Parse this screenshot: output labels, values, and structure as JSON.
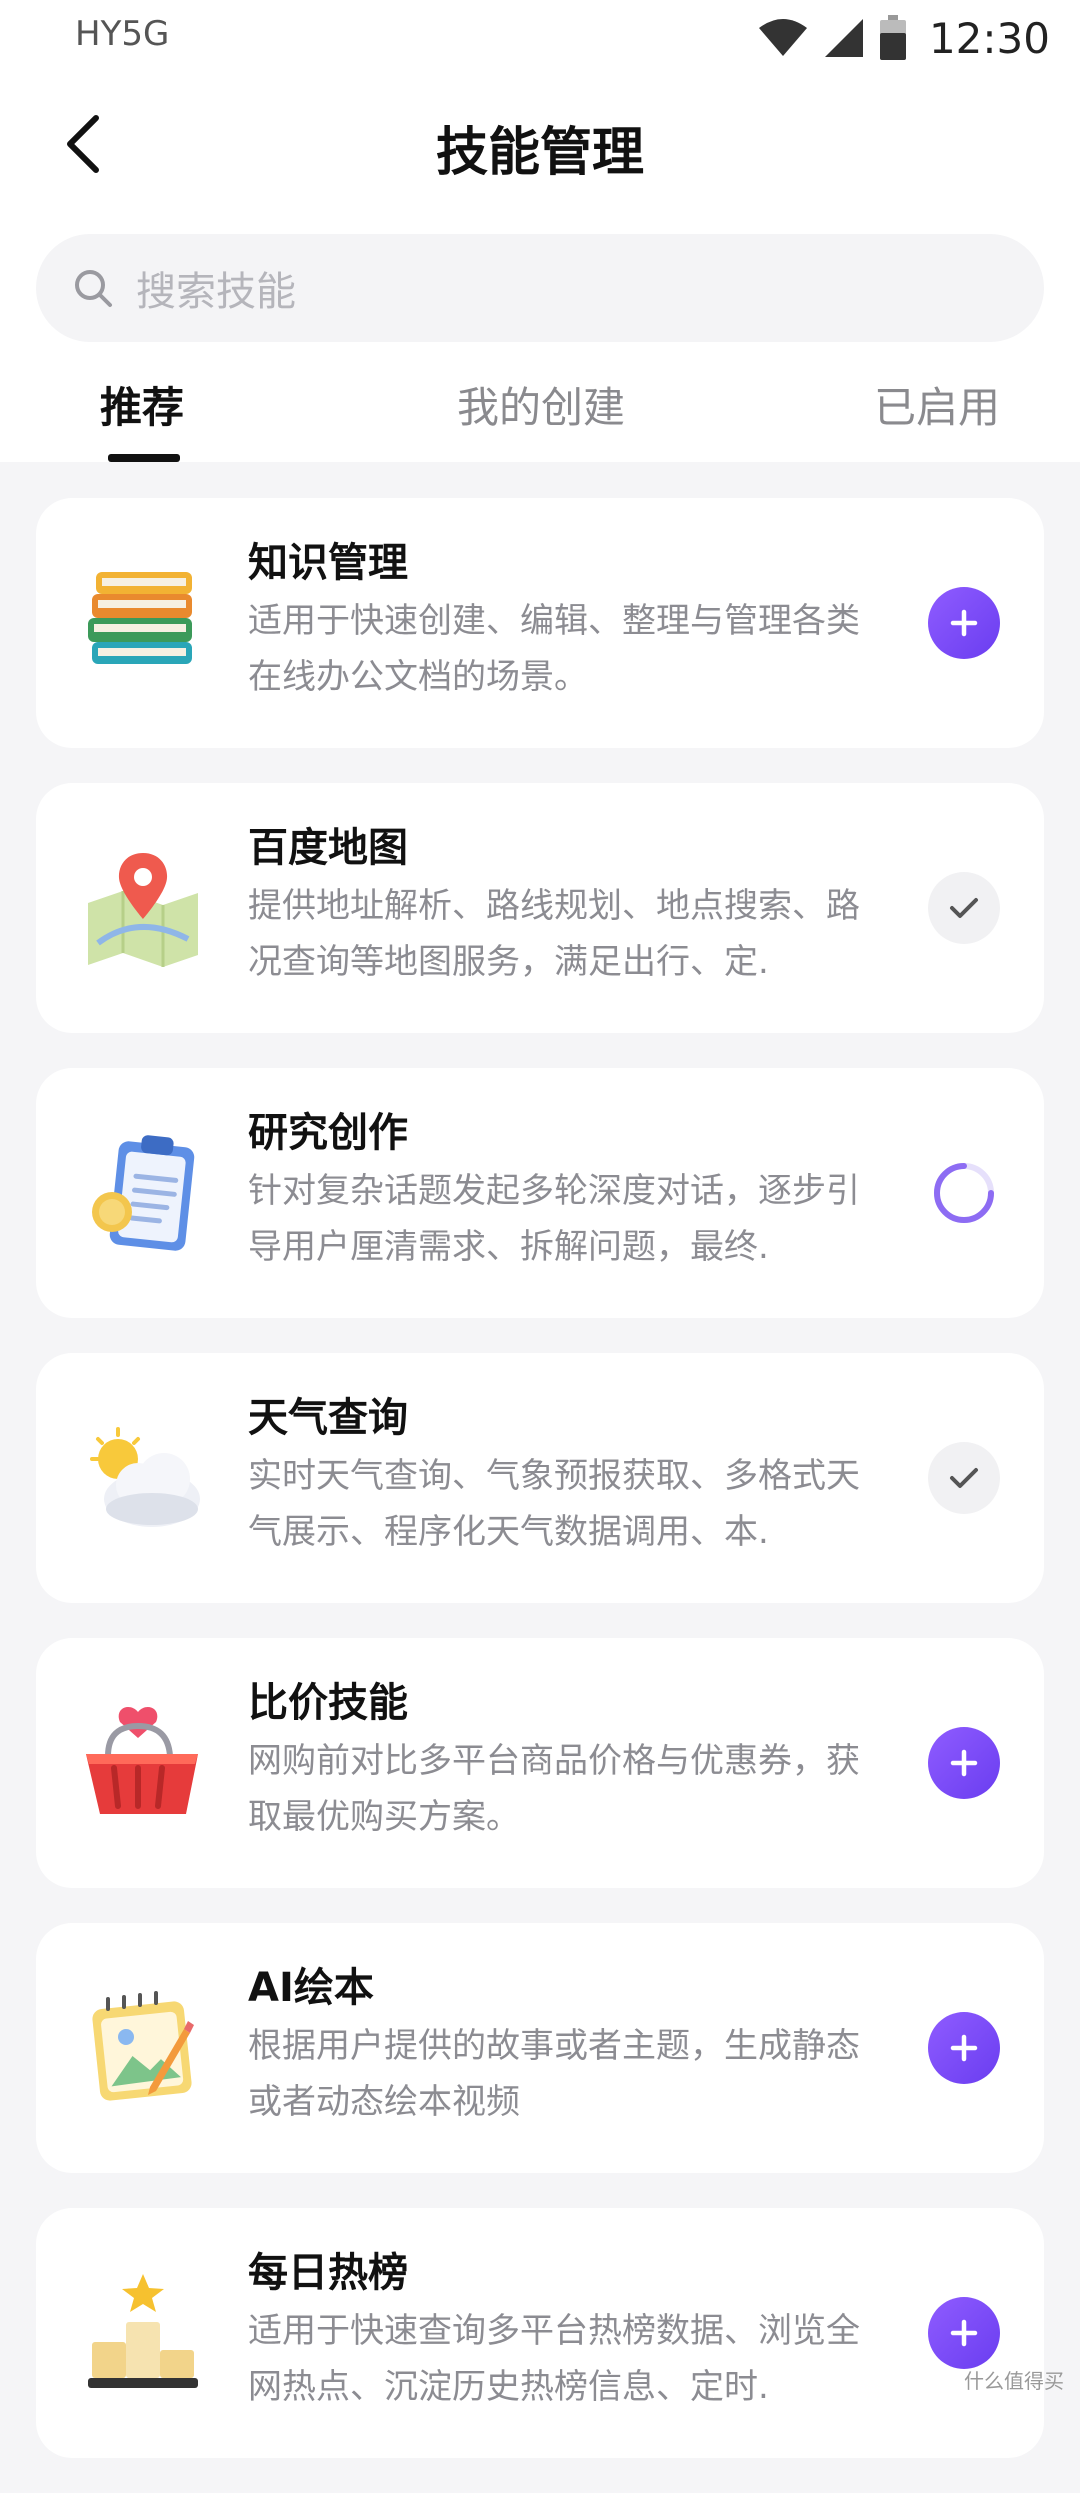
{
  "status_bar": {
    "carrier": "HY5G",
    "time": "12:30"
  },
  "header": {
    "title": "技能管理"
  },
  "search": {
    "placeholder": "搜索技能"
  },
  "tabs": [
    {
      "label": "推荐",
      "active": true
    },
    {
      "label": "我的创建",
      "active": false
    },
    {
      "label": "已启用",
      "active": false
    }
  ],
  "skills": [
    {
      "title": "知识管理",
      "desc": "适用于快速创建、编辑、整理与管理各类在线办公文档的场景。",
      "icon": "books-icon",
      "state": "add"
    },
    {
      "title": "百度地图",
      "desc": "提供地址解析、路线规划、地点搜索、路况查询等地图服务，满足出行、定.",
      "icon": "map-pin-icon",
      "state": "enabled"
    },
    {
      "title": "研究创作",
      "desc": "针对复杂话题发起多轮深度对话，逐步引导用户厘清需求、拆解问题，最终.",
      "icon": "clipboard-icon",
      "state": "loading"
    },
    {
      "title": "天气查询",
      "desc": "实时天气查询、气象预报获取、多格式天气展示、程序化天气数据调用、本.",
      "icon": "weather-icon",
      "state": "enabled"
    },
    {
      "title": "比价技能",
      "desc": "网购前对比多平台商品价格与优惠券，获取最优购买方案。",
      "icon": "basket-icon",
      "state": "add"
    },
    {
      "title": "AI绘本",
      "desc": "根据用户提供的故事或者主题，生成静态或者动态绘本视频",
      "icon": "sketchbook-icon",
      "state": "add"
    },
    {
      "title": "每日热榜",
      "desc": "适用于快速查询多平台热榜数据、浏览全网热点、沉淀历史热榜信息、定时.",
      "icon": "podium-icon",
      "state": "add"
    }
  ],
  "watermark": "什么值得买",
  "colors": {
    "accent": "#7b4cf7",
    "background": "#f5f5f7",
    "muted_text": "#8c8c92"
  }
}
